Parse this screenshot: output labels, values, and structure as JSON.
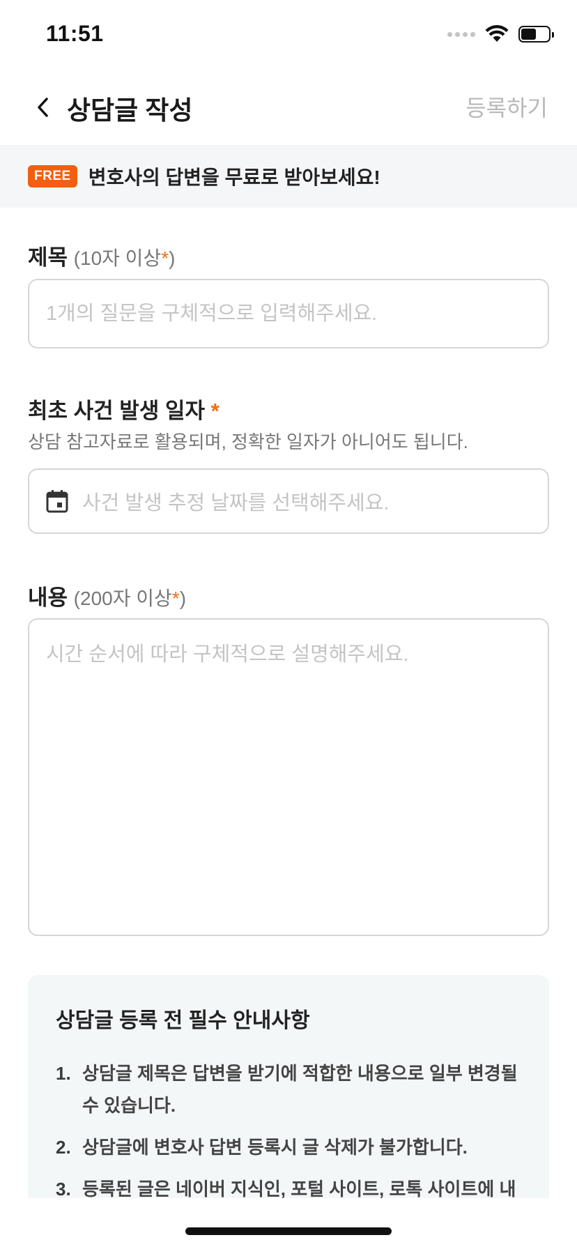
{
  "status_bar": {
    "time": "11:51"
  },
  "header": {
    "title": "상담글 작성",
    "submit_label": "등록하기"
  },
  "banner": {
    "badge": "FREE",
    "text": "변호사의 답변을 무료로 받아보세요!"
  },
  "title_field": {
    "label": "제목",
    "hint_open": "(10자 이상",
    "required_mark": "*",
    "hint_close": ")",
    "placeholder": "1개의 질문을 구체적으로 입력해주세요.",
    "value": ""
  },
  "date_field": {
    "label": "최초 사건 발생 일자",
    "required_mark": "*",
    "helper": "상담 참고자료로 활용되며, 정확한 일자가 아니어도 됩니다.",
    "placeholder": "사건 발생 추정 날짜를 선택해주세요."
  },
  "content_field": {
    "label": "내용",
    "hint_open": "(200자 이상",
    "required_mark": "*",
    "hint_close": ")",
    "placeholder": "시간 순서에 따라 구체적으로 설명해주세요.",
    "value": ""
  },
  "notice": {
    "title": "상담글 등록 전 필수 안내사항",
    "items": [
      {
        "num": "1.",
        "text": "상담글 제목은 답변을 받기에 적합한 내용으로 일부 변경될 수 있습니다."
      },
      {
        "num": "2.",
        "text": "상담글에 변호사 답변 등록시 글 삭제가 불가합니다."
      },
      {
        "num": "3.",
        "text": "등록된 글은 네이버 지식인, 포털 사이트, 로톡 사이트에 내"
      }
    ]
  },
  "colors": {
    "accent": "#f26d0f",
    "badge": "#f25f0f",
    "banner_bg": "#f5f6f8",
    "notice_bg": "#f4f7f8"
  }
}
